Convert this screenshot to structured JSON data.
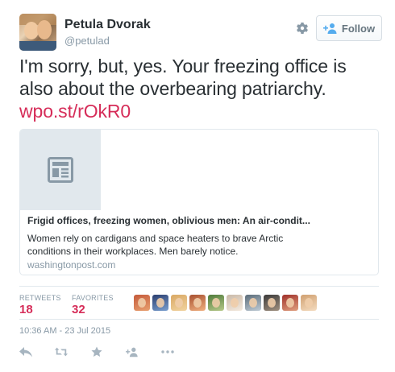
{
  "author": {
    "fullname": "Petula Dvorak",
    "username": "@petulad"
  },
  "header": {
    "follow_label": "Follow",
    "icons": [
      "gear-icon",
      "follow-person-icon"
    ]
  },
  "tweet": {
    "text": "I'm sorry, but, yes. Your freezing office is also about the overbearing patriarchy.",
    "link_text": "wpo.st/rOkR0"
  },
  "card": {
    "title": "Frigid offices, freezing women, oblivious men: An air-condit...",
    "description": "Women rely on cardigans and space heaters to brave Arctic conditions in their workplaces. Men barely notice.",
    "domain": "washingtonpost.com",
    "thumb_icon": "article-icon"
  },
  "stats": {
    "retweets_label": "RETWEETS",
    "retweets_count": "18",
    "favorites_label": "FAVORITES",
    "favorites_count": "32"
  },
  "favoriters": [
    {
      "colors": [
        "#c45a3a",
        "#e8a070"
      ]
    },
    {
      "colors": [
        "#2a3d6e",
        "#7aa0d0"
      ]
    },
    {
      "colors": [
        "#d9a864",
        "#f1d3a0"
      ]
    },
    {
      "colors": [
        "#a85030",
        "#f0b080"
      ]
    },
    {
      "colors": [
        "#4e7a3a",
        "#b7c98a"
      ]
    },
    {
      "colors": [
        "#c9b9a8",
        "#f4eadf"
      ]
    },
    {
      "colors": [
        "#5a6b78",
        "#c0ccd6"
      ]
    },
    {
      "colors": [
        "#3a3a3a",
        "#a09080"
      ]
    },
    {
      "colors": [
        "#a0302a",
        "#e0a080"
      ]
    },
    {
      "colors": [
        "#d0a070",
        "#f4dcc0"
      ]
    }
  ],
  "timestamp": "10:36 AM - 23 Jul 2015",
  "actions": [
    "reply-icon",
    "retweet-icon",
    "favorite-icon",
    "follow-icon",
    "more-icon"
  ],
  "colors": {
    "link": "#d62d59",
    "muted": "#8899a6",
    "text": "#292f33"
  }
}
